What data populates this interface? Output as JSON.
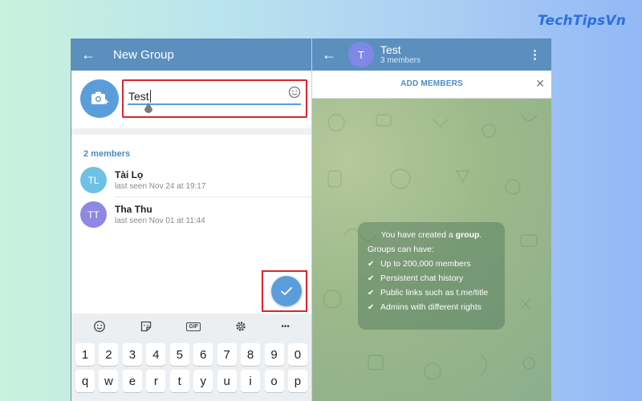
{
  "brand": "TechTipsVn",
  "left": {
    "title": "New Group",
    "group_name_value": "Test",
    "members_label": "2 members",
    "members": [
      {
        "initials": "TL",
        "name": "Tài Lọ",
        "status": "last seen Nov 24 at 19:17",
        "color": "#6ec1e4"
      },
      {
        "initials": "TT",
        "name": "Tha Thu",
        "status": "last seen Nov 01 at 11:44",
        "color": "#8f87e0"
      }
    ],
    "keyboard": {
      "toolbar": [
        "emoji-icon",
        "sticker-icon",
        "gif-icon",
        "settings-icon",
        "more-icon"
      ],
      "gif_label": "GIF",
      "more_label": "•••",
      "number_row": [
        "1",
        "2",
        "3",
        "4",
        "5",
        "6",
        "7",
        "8",
        "9",
        "0"
      ],
      "letter_row": [
        "q",
        "w",
        "e",
        "r",
        "t",
        "y",
        "u",
        "i",
        "o",
        "p"
      ]
    }
  },
  "right": {
    "group_initial": "T",
    "group_name": "Test",
    "group_sub": "3 members",
    "add_members": "ADD MEMBERS",
    "info": {
      "line1_pre": "You have created a ",
      "line1_bold": "group",
      "line1_post": ".",
      "line2": "Groups can have:",
      "items": [
        "Up to 200,000 members",
        "Persistent chat history",
        "Public links such as t.me/title",
        "Admins with different rights"
      ]
    }
  },
  "colors": {
    "header": "#5b8fbe",
    "accent": "#5b9ddb",
    "highlight": "#d8262d"
  }
}
